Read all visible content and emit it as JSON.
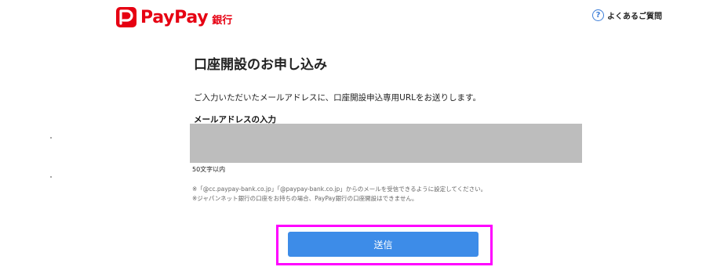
{
  "header": {
    "brand_name": "PayPay",
    "brand_sub": "銀行",
    "faq_icon": "?",
    "faq_label": "よくあるご質問"
  },
  "form": {
    "title": "口座開設のお申し込み",
    "description": "ご入力いただいたメールアドレスに、口座開設申込専用URLをお送りします。",
    "email_label": "メールアドレスの入力",
    "email_value": "",
    "email_hint": "50文字以内",
    "notes": [
      "※「@cc.paypay-bank.co.jp」「@paypay-bank.co.jp」からのメールを受信できるように設定してください。",
      "※ジャパンネット銀行の口座をお持ちの場合、PayPay銀行の口座開設はできません。"
    ],
    "submit_label": "送信"
  },
  "colors": {
    "brand_red": "#e60012",
    "button_blue": "#3d8ce8",
    "highlight_magenta": "#ff00ff",
    "input_gray": "#bdbdbd"
  }
}
